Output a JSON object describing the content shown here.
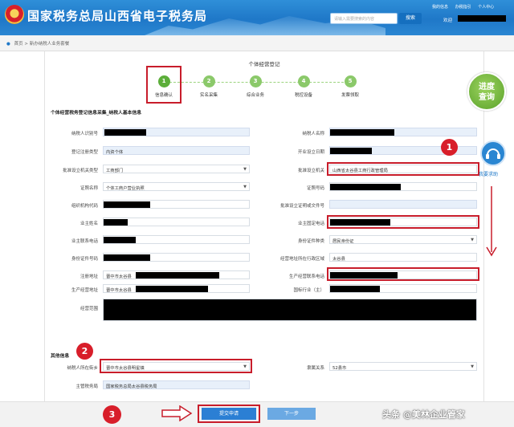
{
  "header": {
    "title": "国家税务总局山西省电子税务局",
    "search_placeholder": "请输入需要搜索的内容",
    "search_button": "搜索",
    "links": [
      "我的信息",
      "办税指引",
      "个人中心"
    ],
    "welcome": "欢迎"
  },
  "breadcrumb": {
    "home": "首页",
    "current": "新办纳税人业务套餐"
  },
  "page_title": "个体经营登记",
  "steps": [
    {
      "num": "1",
      "label": "信息确认"
    },
    {
      "num": "2",
      "label": "实名采集"
    },
    {
      "num": "3",
      "label": "综合业务"
    },
    {
      "num": "4",
      "label": "税控设备"
    },
    {
      "num": "5",
      "label": "发票领取"
    }
  ],
  "section1_title": "个体经营税务登记信息采集_纳税人基本信息",
  "section2_title": "其他信息",
  "form": {
    "taxpayer_id": "纳税人识别号",
    "taxpayer_name": "纳税人名称",
    "reg_type": "登记注册类型",
    "reg_type_value": "内资个体",
    "open_date": "开业设立日期",
    "approval_type": "批准设立机关类型",
    "approval_type_value": "工商部门",
    "approval_org": "批准设立机关",
    "approval_org_value": "山西省太谷县工商行政管理局",
    "cert_name": "证照名称",
    "cert_name_value": "个体工商户营业执照",
    "cert_no": "证照号码",
    "org_code": "组织机构代码",
    "approval_doc": "批准设立证明或文件号",
    "owner_name": "业主姓名",
    "owner_phone": "业主固定电话",
    "owner_contact": "业主联系电话",
    "id_type": "身份证件种类",
    "id_type_value": "居民身份证",
    "id_no": "身份证件号码",
    "district": "经营地址所在行政区域",
    "district_value": "太谷县",
    "reg_address": "注册地址",
    "reg_address_value": "晋中市太谷县",
    "prod_phone": "生产经营联系电话",
    "prod_address": "生产经营地址",
    "prod_address_value": "晋中市太谷县",
    "industry": "国标行业（主）",
    "scope": "经营范围",
    "street": "纳税人所在街乡",
    "street_value": "晋中市太谷县明星镇",
    "affiliation": "隶属关系",
    "affiliation_value": "52县市",
    "tax_office": "主管税务局",
    "tax_office_value": "国家税务总局太谷县税务局"
  },
  "badge": {
    "line1": "进度",
    "line2": "查询"
  },
  "helper_label": "我要求助",
  "markers": [
    "1",
    "2",
    "3"
  ],
  "buttons": {
    "submit": "提交申请",
    "next": "下一步"
  },
  "watermark": "头条 @美林企业管家",
  "colors": {
    "header_blue": "#1f78c8",
    "step_green": "#5cae3a",
    "highlight_red": "#c81d2b"
  }
}
